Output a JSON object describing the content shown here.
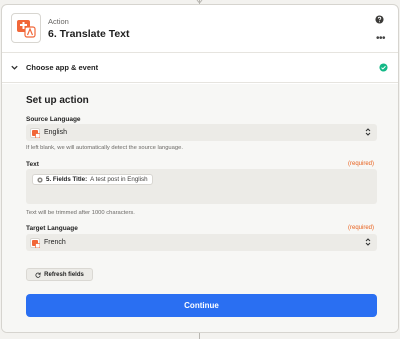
{
  "step": {
    "label": "Action",
    "title": "6. Translate Text",
    "app_icon": "translate-app-icon"
  },
  "header_icons": [
    "help-icon",
    "more-icon"
  ],
  "section": {
    "label": "Choose app & event",
    "status": "complete"
  },
  "setup": {
    "title": "Set up action"
  },
  "source_language": {
    "label": "Source Language",
    "value": "English",
    "hint": "If left blank, we will automatically detect the source language."
  },
  "text_field": {
    "label": "Text",
    "required": "(required)",
    "pill_key": "5. Fields Title:",
    "pill_value": "A test post in English",
    "hint": "Text will be trimmed after 1000 characters."
  },
  "target_language": {
    "label": "Target Language",
    "required": "(required)",
    "value": "French"
  },
  "buttons": {
    "refresh": "Refresh fields",
    "continue": "Continue"
  },
  "colors": {
    "accent": "#2a6ff2",
    "required": "#e8601c",
    "success": "#12b886",
    "app_orange": "#f16739"
  }
}
